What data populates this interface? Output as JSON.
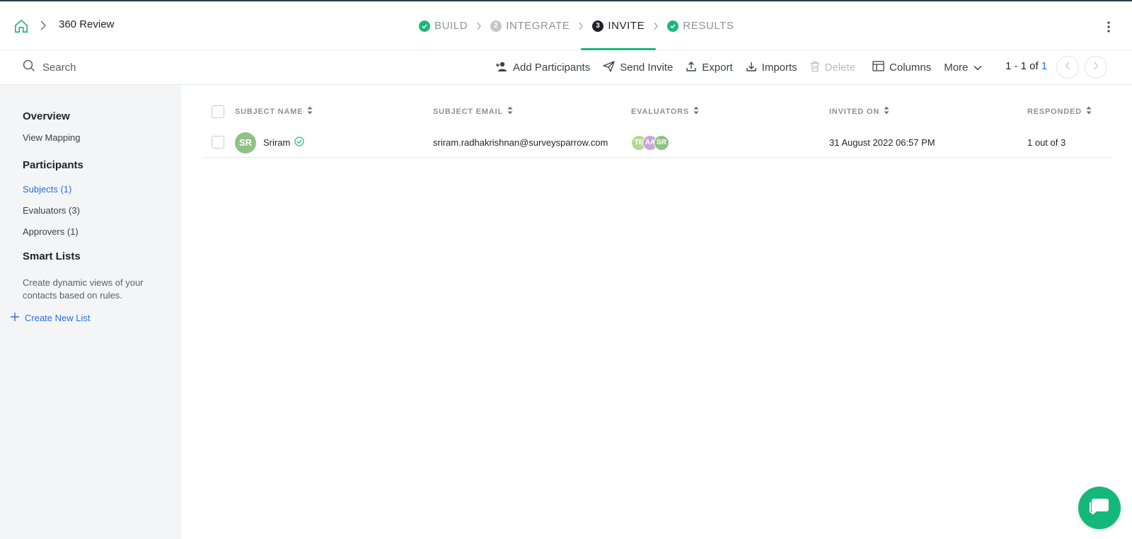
{
  "header": {
    "breadcrumb_title": "360 Review",
    "steps": [
      {
        "label": "BUILD",
        "state": "done"
      },
      {
        "label": "INTEGRATE",
        "number": "2",
        "state": "pending"
      },
      {
        "label": "INVITE",
        "number": "3",
        "state": "active"
      },
      {
        "label": "RESULTS",
        "state": "done"
      }
    ]
  },
  "toolbar": {
    "search_placeholder": "Search",
    "add_participants": "Add Participants",
    "send_invite": "Send Invite",
    "export": "Export",
    "imports": "Imports",
    "delete": "Delete",
    "columns": "Columns",
    "more": "More",
    "pager_prefix": "1 - 1 of ",
    "pager_total": "1"
  },
  "sidebar": {
    "overview": "Overview",
    "view_mapping": "View Mapping",
    "participants": "Participants",
    "subjects": "Subjects (1)",
    "evaluators": "Evaluators (3)",
    "approvers": "Approvers (1)",
    "smart_lists": "Smart Lists",
    "smart_lists_desc": "Create dynamic views of your contacts based on rules.",
    "create_new_list": "Create New List"
  },
  "table": {
    "columns": [
      "SUBJECT NAME",
      "SUBJECT EMAIL",
      "EVALUATORS",
      "INVITED ON",
      "RESPONDED"
    ],
    "rows": [
      {
        "initials": "SR",
        "name": "Sriram",
        "email": "sriram.radhakrishnan@surveysparrow.com",
        "evaluators": [
          {
            "initials": "TE",
            "color": "#b5d98f"
          },
          {
            "initials": "AA",
            "color": "#c9a6d9"
          },
          {
            "initials": "SR",
            "color": "#8fc383"
          }
        ],
        "invited_on": "31 August 2022 06:57 PM",
        "responded": "1 out of 3"
      }
    ]
  },
  "colors": {
    "accent_green": "#1db77a",
    "link_blue": "#2a6fdb"
  }
}
